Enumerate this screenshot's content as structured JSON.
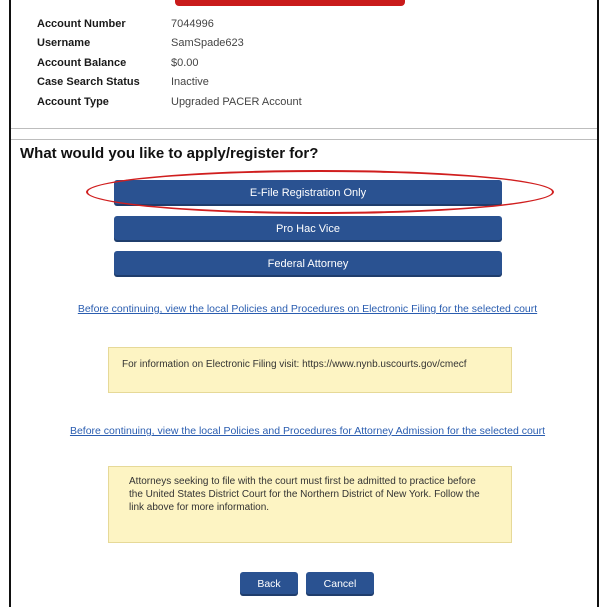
{
  "account": {
    "rows": [
      {
        "label": "Account Number",
        "value": "7044996"
      },
      {
        "label": "Username",
        "value": "SamSpade623"
      },
      {
        "label": "Account Balance",
        "value": "$0.00"
      },
      {
        "label": "Case Search Status",
        "value": "Inactive"
      },
      {
        "label": "Account Type",
        "value": "Upgraded PACER Account"
      }
    ]
  },
  "main": {
    "question": "What would you like to apply/register for?",
    "options": [
      {
        "label": "E-File Registration Only"
      },
      {
        "label": "Pro Hac Vice"
      },
      {
        "label": "Federal Attorney"
      }
    ],
    "policy_link": "Before continuing, view the local Policies and Procedures on Electronic Filing for the selected court",
    "efile_info": "For information on Electronic Filing visit: https://www.nynb.uscourts.gov/cmecf",
    "admission_link": "Before continuing, view the local Policies and Procedures for Attorney Admission for the selected court",
    "admission_info": "Attorneys seeking to file with the court must first be admitted to practice before the United States District Court for the Northern District of New York. Follow the link above for more information."
  },
  "footer": {
    "back_label": "Back",
    "cancel_label": "Cancel"
  },
  "colors": {
    "button_blue": "#2a5291",
    "highlight_red": "#d01e1e",
    "info_yellow": "#fdf4c3",
    "link_blue": "#2a5db0"
  }
}
